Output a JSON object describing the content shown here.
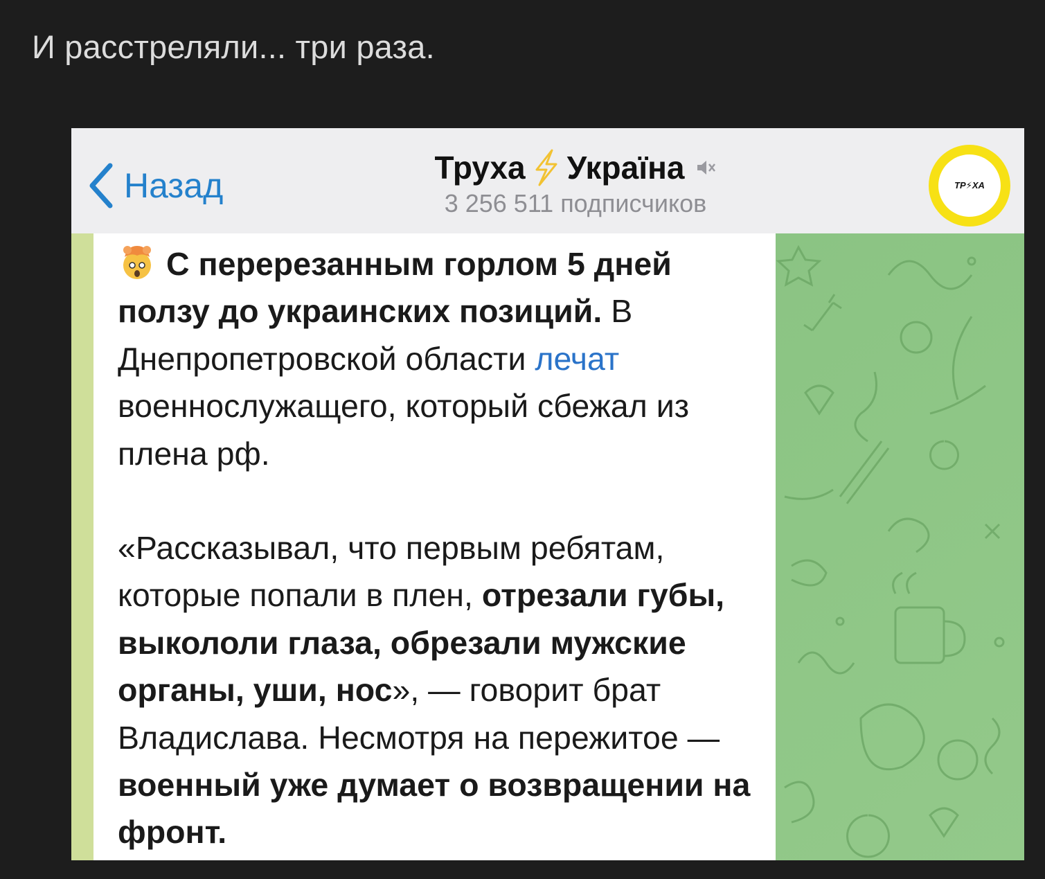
{
  "caption": "И расстреляли... три раза.",
  "header": {
    "back_label": "Назад",
    "title_left": "Труха",
    "title_right": "Україна",
    "subscribers": "3 256 511 подписчиков",
    "avatar_text": "ТР⚡ХА",
    "accent_color": "#2481cc",
    "avatar_ring_color": "#f7e115"
  },
  "message": {
    "line1_bold": "С перерезанным горлом 5 дней ползу до украинских позиций.",
    "line1_text": " В Днепропетровской области ",
    "link_text": "лечат",
    "line1_rest": " военнослужащего, который сбежал из плена рф.",
    "para2_a": "«Рассказывал, что первым ребятам, которые попали в плен, ",
    "para2_bold": "отрезали губы, выкололи глаза, обрезали мужские органы, уши, нос",
    "para2_b": "», — говорит брат Владислава. Несмотря на пережитое — ",
    "para2_bold2": "военный уже думает о возвращении на фронт."
  },
  "colors": {
    "chat_background": "#88c383",
    "header_background": "#eeeef0"
  }
}
